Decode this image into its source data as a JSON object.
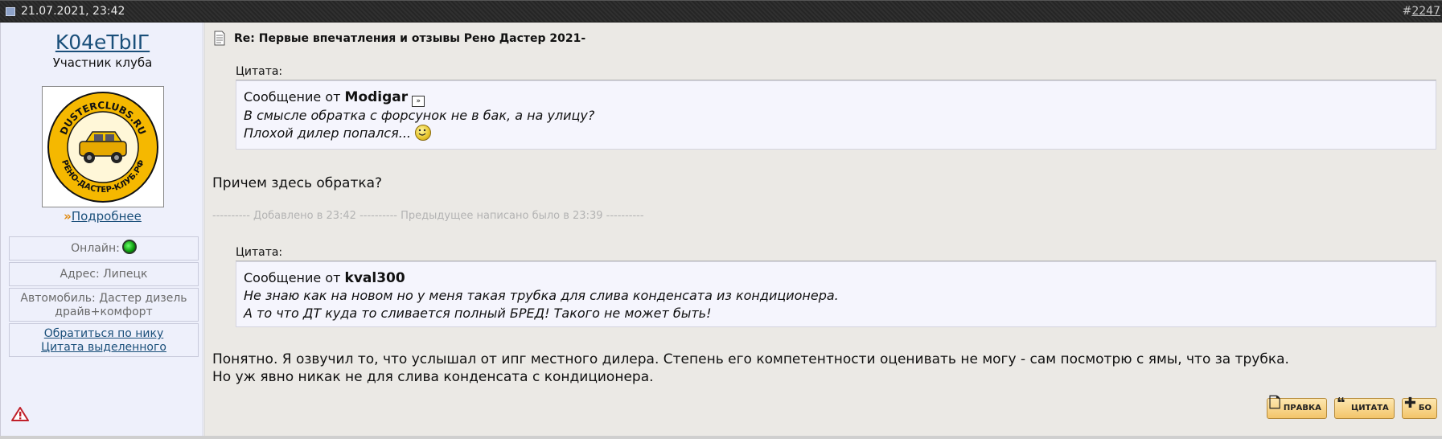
{
  "header": {
    "date": "21.07.2021, 23:42",
    "post_hash": "#",
    "post_number": "2247"
  },
  "user": {
    "name": "K04eTbIГ",
    "title": "Участник клуба",
    "avatar_text_top": "DUSTERCLUBS.RU",
    "avatar_text_bottom": "РЕНО-ДАСТЕР-КЛУБ.РФ",
    "more_arrow": "»",
    "more_label": "Подробнее",
    "online_label": "Онлайн:",
    "address": "Адрес: Липецк",
    "car_line1": "Автомобиль: Дастер дизель",
    "car_line2": "драйв+комфорт",
    "link_nick": "Обратиться по нику",
    "link_quote": "Цитата выделенного"
  },
  "post": {
    "title": "Re: Первые впечатления и отзывы Рено Дастер 2021-",
    "quote1": {
      "label": "Цитата:",
      "prefix": "Сообщение от",
      "author": "Modigar",
      "line1": "В смысле обратка с форсунок не в бак, а на улицу?",
      "line2": "Плохой дилер попался..."
    },
    "text1": "Причем здесь обратка?",
    "added_note": "---------- Добавлено в 23:42 ---------- Предыдущее написано было в 23:39 ----------",
    "quote2": {
      "label": "Цитата:",
      "prefix": "Сообщение от",
      "author": "kval300",
      "line1": "Не знаю как на новом но у меня такая трубка для слива конденсата из кондиционера.",
      "line2": "А то что ДТ куда то сливается полный БРЕД! Такого не может быть!"
    },
    "text2_line1": "Понятно. Я озвучил то, что услышал от ипг местного дилера. Степень его компетентности оценивать не могу - сам посмотрю с ямы, что за трубка.",
    "text2_line2": "Но уж явно никак не для слива конденсата с кондиционера."
  },
  "actions": {
    "edit": "ПРАВКА",
    "quote": "ЦИТАТА",
    "multi": "БО"
  },
  "colors": {
    "link": "#1a4f7a",
    "content_bg": "#ebe9e5",
    "panel_bg": "#eef0fb",
    "button": "#f3c56a"
  }
}
